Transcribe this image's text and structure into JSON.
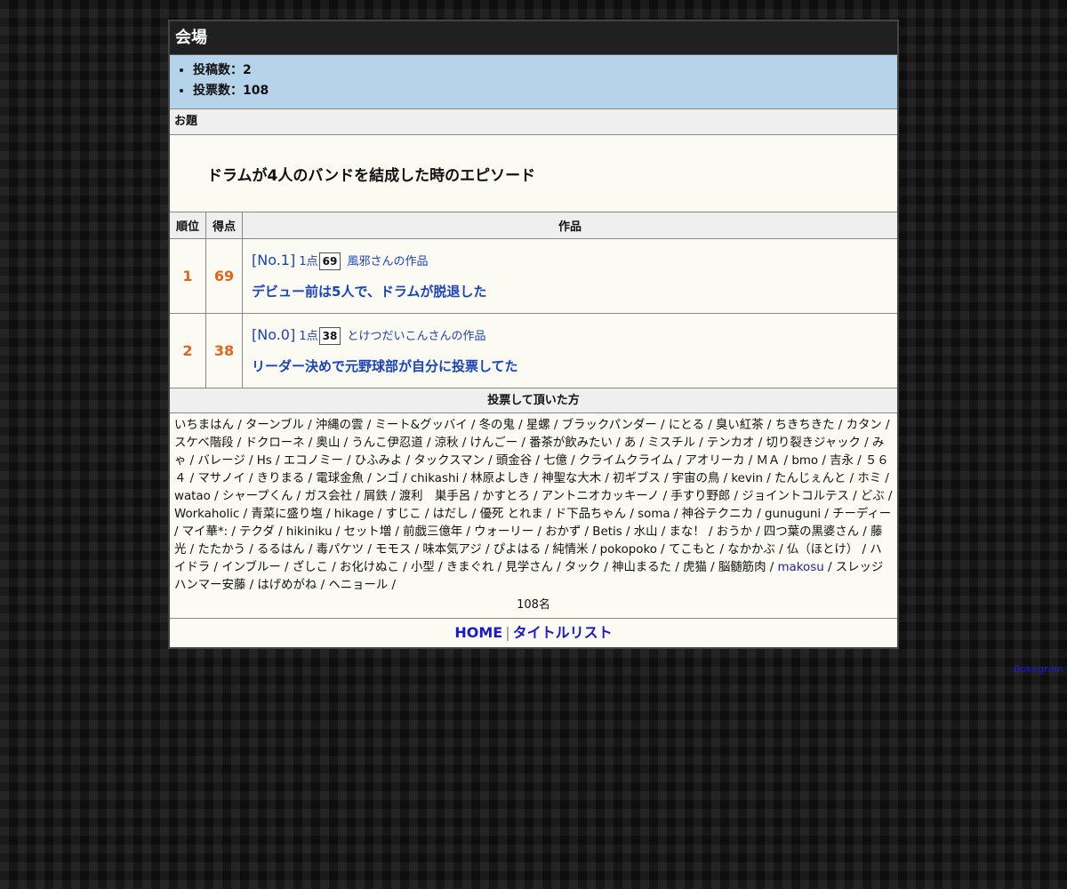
{
  "header": {
    "title": "会場"
  },
  "stats": {
    "posts": "投稿数：2",
    "votes": "投票数：108"
  },
  "topic": {
    "label": "お題",
    "text": "ドラムが4人のバンドを結成した時のエピソード"
  },
  "results": {
    "columns": {
      "rank": "順位",
      "score": "得点",
      "work": "作品"
    },
    "rows": [
      {
        "rank": "1",
        "score": "69",
        "no": "[No.1]",
        "points_label": "1点",
        "count": "69",
        "author": "風邪さんの作品",
        "text": "デビュー前は5人で、ドラムが脱退した"
      },
      {
        "rank": "2",
        "score": "38",
        "no": "[No.0]",
        "points_label": "1点",
        "count": "38",
        "author": "とけつだいこんさんの作品",
        "text": "リーダー決めで元野球部が自分に投票してた"
      }
    ]
  },
  "voters": {
    "label": "投票して頂いた方",
    "list_before": "いちまはん / ターンブル / 沖縄の雲 / ミート&グッバイ / 冬の鬼 / 星螺 / ブラックパンダー / にとる / 臭い紅茶 / ちきちきた / カタン / スケベ階段 / ドクローネ / 奥山 / うんこ伊忍道 / 涼秋 / けんごー / 番茶が飲みたい / あ / ミスチル / テンカオ / 切り裂きジャック / みゃ / バレージ / Hs / エコノミー / ひふみよ / タックスマン / 頭金谷 / 七億 / クライムクライム / アオリーカ / ＭＡ / bmo / 吉永 / ５６４ / マサノイ / きりまる / 電球金魚 / ンゴ / chikashi / 林原よしき / 神聖な大木 / 初ギブス / 宇宙の鳥 / kevin / たんじぇんと / ホミ / watao / シャープくん / ガス会社 / 屑鉄 / 渡利　巣手呂 / かすとろ / アントニオカッキーノ / 手すり野郎 / ジョイントコルテス / どぶ / Workaholic / 青菜に盛り塩 / hikage / すじこ / はだし / 優死 とれま / ド下品ちゃん / soma / 神谷テクニカ / gunuguni / チーディー / マイ華*: / テクダ / hikiniku / セット増 / 前戯三億年 / ウォーリー / おかず / Betis / 水山 / まな！ / おうか / 四つ葉の黒婆さん / 藤光 / たたかう / るるはん / 毒パケツ / モモス / 味本気アジ / ぴよはる / 純情米 / pokopoko / てこもと / なかかぶ / 仏（ほとけ） / ハイドラ / インブルー / ざしこ / お化けぬこ / 小型 / きまぐれ / 見学さん / タック / 神山まるた / 虎猫 / 脳髄筋肉 / ",
    "link_name": "makosu",
    "list_after": " / スレッジハンマー安藤 / はげめがね / ヘニョール /",
    "count": "108名"
  },
  "footer": {
    "home": "HOME",
    "separator": "|",
    "title_list": "タイトルリスト"
  },
  "credit": "Bokegram"
}
